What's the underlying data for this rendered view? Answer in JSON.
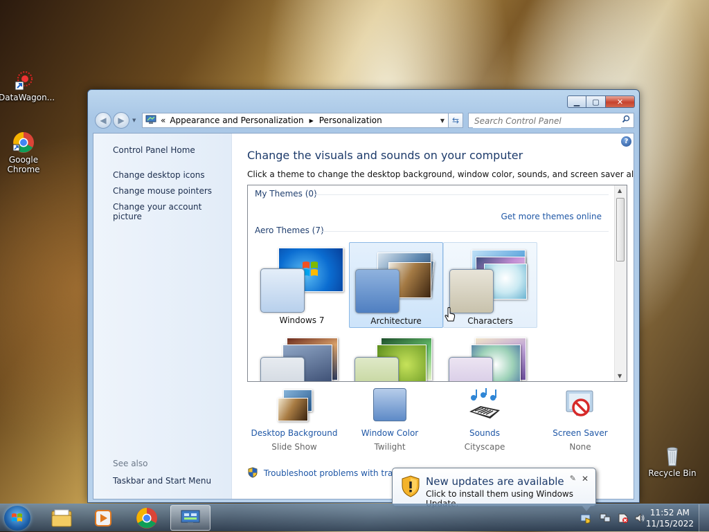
{
  "desktop": {
    "icons": [
      {
        "label": "DataWagon..."
      },
      {
        "label": "Google Chrome"
      },
      {
        "label": "Recycle Bin"
      }
    ]
  },
  "window": {
    "breadcrumb": {
      "root": "«",
      "part1": "Appearance and Personalization",
      "part2": "Personalization"
    },
    "search_placeholder": "Search Control Panel",
    "leftpane": {
      "home": "Control Panel Home",
      "items": [
        "Change desktop icons",
        "Change mouse pointers",
        "Change your account picture"
      ],
      "see_also_heading": "See also",
      "see_also": [
        "Taskbar and Start Menu"
      ]
    },
    "main": {
      "heading": "Change the visuals and sounds on your computer",
      "subheading": "Click a theme to change the desktop background, window color, sounds, and screen saver all at once.",
      "my_themes": "My Themes (0)",
      "get_more": "Get more themes online",
      "aero_themes": "Aero Themes (7)",
      "themes": [
        {
          "label": "Windows 7"
        },
        {
          "label": "Architecture",
          "selected": true
        },
        {
          "label": "Characters"
        }
      ],
      "quick": [
        {
          "label": "Desktop Background",
          "sub": "Slide Show"
        },
        {
          "label": "Window Color",
          "sub": "Twilight"
        },
        {
          "label": "Sounds",
          "sub": "Cityscape"
        },
        {
          "label": "Screen Saver",
          "sub": "None"
        }
      ],
      "troubleshoot": "Troubleshoot problems with transpa"
    }
  },
  "notification": {
    "title": "New updates are available",
    "message": "Click to install them using Windows Update."
  },
  "taskbar": {
    "time": "11:52 AM",
    "date": "11/15/2022"
  }
}
